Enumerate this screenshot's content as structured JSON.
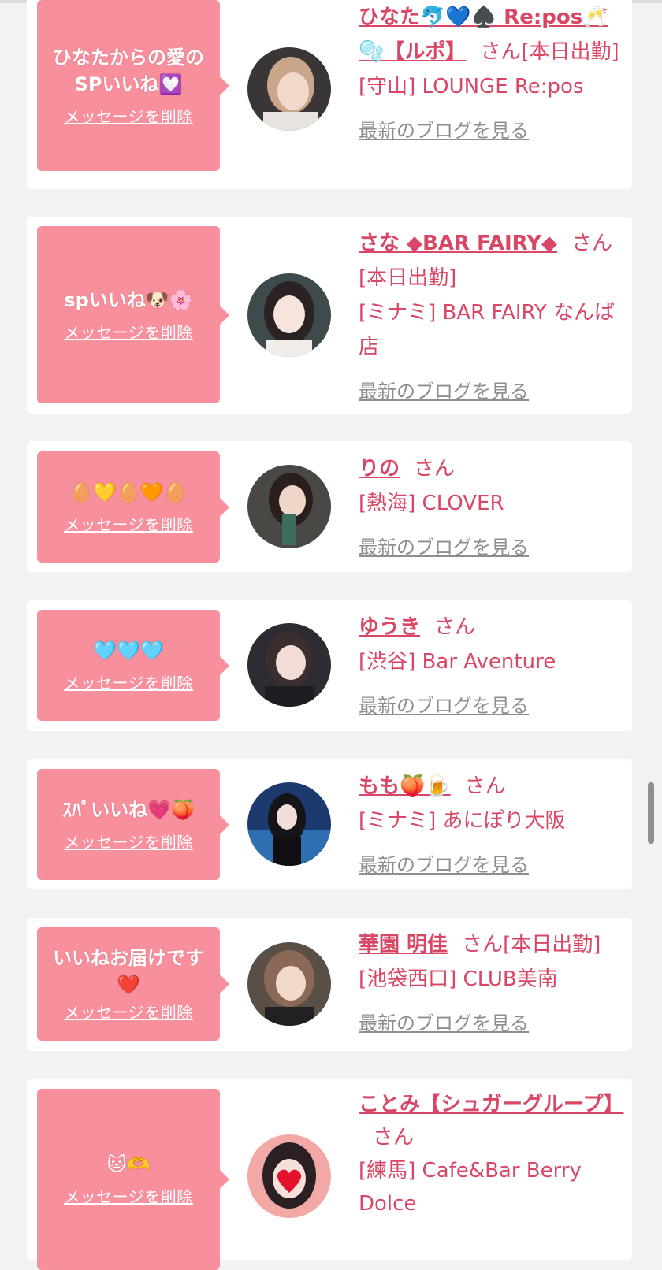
{
  "cards": [
    {
      "message": "ひなたからの愛のSPいいね💟",
      "delete_label": "メッセージを削除",
      "name": "ひなた🐬💙♠️ Re:pos🥂🫧【ルポ】",
      "san": "さん",
      "status": "[本日出勤]",
      "shop": "[守山] LOUNGE Re:pos",
      "blog_label": "最新のブログを見る"
    },
    {
      "message": "spいいね🐶🌸",
      "delete_label": "メッセージを削除",
      "name": "さな ◆BAR FAIRY◆",
      "san": "さん",
      "status": "[本日出勤]",
      "shop": "[ミナミ] BAR FAIRY なんば店",
      "blog_label": "最新のブログを見る"
    },
    {
      "message": "🥚💛🥚🧡🥚",
      "delete_label": "メッセージを削除",
      "name": "りの",
      "san": "さん",
      "status": "",
      "shop": "[熱海] CLOVER",
      "blog_label": "最新のブログを見る"
    },
    {
      "message": "🩵🩵🩵",
      "delete_label": "メッセージを削除",
      "name": "ゆうき",
      "san": "さん",
      "status": "",
      "shop": "[渋谷] Bar Aventure",
      "blog_label": "最新のブログを見る"
    },
    {
      "message": "ｽﾊﾟいいね💗🍑",
      "delete_label": "メッセージを削除",
      "name": "もも🍑🍺",
      "san": "さん",
      "status": "",
      "shop": "[ミナミ] あにぽり大阪",
      "blog_label": "最新のブログを見る"
    },
    {
      "message": "いいねお届けです❤️",
      "delete_label": "メッセージを削除",
      "name": "華園 明佳",
      "san": "さん",
      "status": "[本日出勤]",
      "shop": "[池袋西口] CLUB美南",
      "blog_label": "最新のブログを見る"
    },
    {
      "message": "🐱🫶",
      "delete_label": "メッセージを削除",
      "name": "ことみ【シュガーグループ】",
      "san": "さん",
      "status": "",
      "shop": "[練馬] Cafe&Bar Berry Dolce",
      "blog_label": ""
    }
  ],
  "colors": {
    "bubble": "#f88f9c",
    "accent_text": "#d84866",
    "muted_link": "#8e8e8e",
    "page_bg": "#f2f2f2"
  }
}
